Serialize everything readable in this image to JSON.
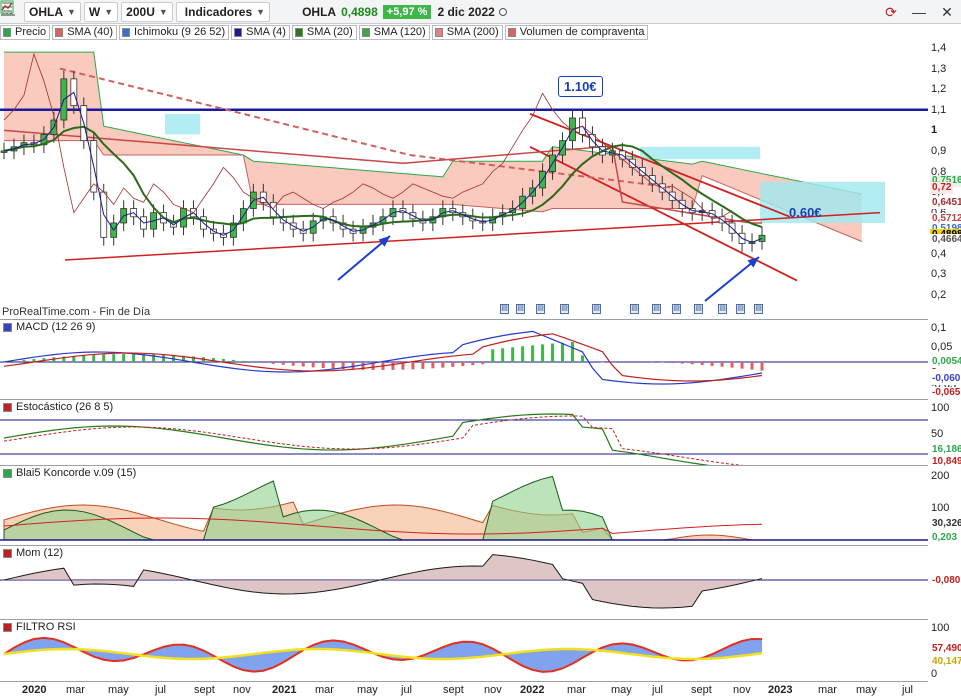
{
  "toolbar": {
    "ticker": "OHLA",
    "period": "W",
    "bars": "200U",
    "indicators_label": "Indicadores",
    "symbol": "OHLA",
    "price": "0,4898",
    "change": "+5,97 %",
    "date": "2 dic 2022"
  },
  "legend": [
    {
      "label": "Precio",
      "color": "#2aa84a"
    },
    {
      "label": "SMA (40)",
      "color": "#e06060"
    },
    {
      "label": "Ichimoku (9 26 52)",
      "color": "#3a70c8"
    },
    {
      "label": "SMA (4)",
      "color": "#1a1a8a"
    },
    {
      "label": "SMA (20)",
      "color": "#2a7a1a"
    },
    {
      "label": "SMA (120)",
      "color": "#3aa84a"
    },
    {
      "label": "SMA (200)",
      "color": "#e08080"
    },
    {
      "label": "Volumen de compraventa",
      "color": "#e06060"
    }
  ],
  "main": {
    "source_note": "ProRealTime.com - Fin de Día",
    "anno_high": "1.10€",
    "anno_low": "0.60€",
    "y_ticks": [
      "1,4",
      "1,3",
      "1,2",
      "1,1",
      "1",
      "0,9",
      "0,8",
      "0,7",
      "0,6",
      "0,5",
      "0,4",
      "0,3",
      "0,2"
    ],
    "tags": [
      {
        "text": "0,7516",
        "color": "#2aa84a",
        "bg": "#e8f6ea"
      },
      {
        "text": "0,72",
        "color": "#c02020",
        "bg": "#fde8e8"
      },
      {
        "text": "0,6451",
        "color": "#a03030",
        "bg": "#fff"
      },
      {
        "text": "0,5712",
        "color": "#c04040",
        "bg": "#fff"
      },
      {
        "text": "0,5198",
        "color": "#3a70c8",
        "bg": "#fff"
      },
      {
        "text": "0,4898",
        "color": "#000",
        "bg": "#f5d000"
      },
      {
        "text": "0,4664",
        "color": "#555",
        "bg": "#fff"
      }
    ]
  },
  "macd": {
    "title": "MACD (12 26 9)",
    "y_ticks": [
      "0,1",
      "0,05",
      "0",
      "-0,05"
    ],
    "tags": [
      {
        "text": "0,0054",
        "color": "#2aa84a"
      },
      {
        "text": "-0,060",
        "color": "#3a40c8"
      },
      {
        "text": "-0,065",
        "color": "#c02020"
      }
    ]
  },
  "stoch": {
    "title": "Estocástico (26 8 5)",
    "y_ticks": [
      "100",
      "50"
    ],
    "tags": [
      {
        "text": "16,186",
        "color": "#2aa84a"
      },
      {
        "text": "10,849",
        "color": "#c02020"
      }
    ]
  },
  "koncorde": {
    "title": "Blai5 Koncorde v.09 (15)",
    "y_ticks": [
      "200",
      "100",
      "0"
    ],
    "tags": [
      {
        "text": "30,326",
        "color": "#333"
      },
      {
        "text": "0,203",
        "color": "#2aa84a"
      }
    ]
  },
  "mom": {
    "title": "Mom (12)",
    "y_ticks": [
      "0"
    ],
    "tags": [
      {
        "text": "-0,080",
        "color": "#c02020"
      }
    ]
  },
  "rsi": {
    "title": "FILTRO RSI",
    "y_ticks": [
      "100",
      "0"
    ],
    "tags": [
      {
        "text": "57,490",
        "color": "#c02020"
      },
      {
        "text": "40,147",
        "color": "#c8a800"
      }
    ]
  },
  "x_ticks": [
    "2020",
    "mar",
    "may",
    "jul",
    "sept",
    "nov",
    "2021",
    "mar",
    "may",
    "jul",
    "sept",
    "nov",
    "2022",
    "mar",
    "may",
    "jul",
    "sept",
    "nov",
    "2023",
    "mar",
    "may",
    "jul"
  ],
  "chart_data": {
    "type": "line",
    "title": "OHLA",
    "price_range": [
      0.18,
      1.42
    ],
    "resistance": 1.1,
    "support_label": 0.6,
    "last_price": 0.4898,
    "close": [
      0.9,
      0.92,
      0.94,
      0.93,
      0.98,
      1.05,
      1.25,
      1.12,
      0.95,
      0.7,
      0.48,
      0.55,
      0.62,
      0.58,
      0.52,
      0.6,
      0.55,
      0.53,
      0.62,
      0.58,
      0.52,
      0.5,
      0.48,
      0.55,
      0.62,
      0.7,
      0.65,
      0.58,
      0.55,
      0.52,
      0.5,
      0.56,
      0.58,
      0.55,
      0.52,
      0.5,
      0.53,
      0.55,
      0.58,
      0.62,
      0.6,
      0.57,
      0.55,
      0.58,
      0.62,
      0.6,
      0.58,
      0.56,
      0.55,
      0.58,
      0.6,
      0.62,
      0.68,
      0.72,
      0.8,
      0.88,
      0.95,
      1.06,
      0.98,
      0.92,
      0.88,
      0.9,
      0.86,
      0.82,
      0.78,
      0.74,
      0.7,
      0.66,
      0.62,
      0.6,
      0.61,
      0.58,
      0.55,
      0.5,
      0.45,
      0.46,
      0.49
    ]
  }
}
